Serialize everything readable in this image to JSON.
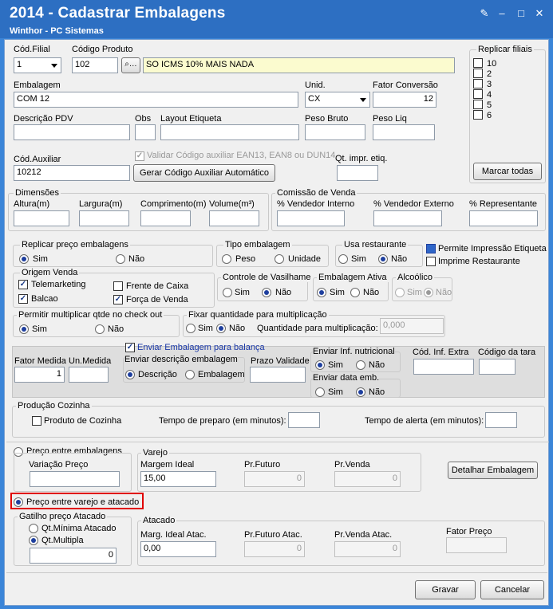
{
  "window": {
    "title": "2014 - Cadastrar Embalagens",
    "subtitle": "Winthor - PC Sistemas",
    "min_icon": "minimize-icon",
    "max_icon": "maximize-icon",
    "close_icon": "close-icon",
    "edit_icon": "edit-icon"
  },
  "top": {
    "filial_label": "Cód.Filial",
    "filial_value": "1",
    "produto_label": "Código Produto",
    "produto_value": "102",
    "produto_desc": "SO ICMS 10% MAIS NADA",
    "embalagem_label": "Embalagem",
    "embalagem_value": "COM 12",
    "unid_label": "Unid.",
    "unid_value": "CX",
    "fator_label": "Fator Conversão",
    "fator_value": "12",
    "desc_pdv_label": "Descrição PDV",
    "obs_label": "Obs",
    "layout_label": "Layout Etiqueta",
    "peso_bruto_label": "Peso Bruto",
    "peso_liq_label": "Peso Liq",
    "cod_aux_label": "Cód.Auxiliar",
    "cod_aux_value": "10212",
    "validar_label": "Validar Código auxiliar EAN13, EAN8 ou DUN14",
    "gerar_button": "Gerar Código Auxiliar Automático",
    "qt_impr_label": "Qt. impr. etiq."
  },
  "replicar": {
    "label": "Replicar filiais",
    "items": [
      "10",
      "2",
      "3",
      "4",
      "5",
      "6"
    ],
    "marcar_button": "Marcar todas"
  },
  "dimensoes": {
    "label": "Dimensões",
    "altura": "Altura(m)",
    "largura": "Largura(m)",
    "comprimento": "Comprimento(m)",
    "volume": "Volume(m³)"
  },
  "comissao": {
    "label": "Comissão de Venda",
    "interno": "% Vendedor Interno",
    "externo": "% Vendedor Externo",
    "representante": "% Representante"
  },
  "replicar_preco": {
    "label": "Replicar preço embalagens",
    "sim": "Sim",
    "nao": "Não"
  },
  "tipo_embalagem": {
    "label": "Tipo embalagem",
    "peso": "Peso",
    "unidade": "Unidade"
  },
  "usa_restaurante": {
    "label": "Usa restaurante",
    "sim": "Sim",
    "nao": "Não"
  },
  "permite_impressao": "Permite Impressão Etiqueta",
  "imprime_restaurante": "Imprime Restaurante",
  "origem_venda": {
    "label": "Origem Venda",
    "telemarketing": "Telemarketing",
    "balcao": "Balcao",
    "frente_caixa": "Frente de Caixa",
    "forca_venda": "Força de Venda"
  },
  "vasilhame": {
    "label": "Controle de Vasilhame",
    "sim": "Sim",
    "nao": "Não"
  },
  "emb_ativa": {
    "label": "Embalagem Ativa",
    "sim": "Sim",
    "nao": "Não"
  },
  "alcoolico": {
    "label": "Alcoólico",
    "sim": "Sim",
    "nao": "Não"
  },
  "permitir_mult": {
    "label": "Permitir multiplicar qtde no check out",
    "sim": "Sim",
    "nao": "Não"
  },
  "fixar_qtd": {
    "label": "Fixar quantidade para multiplicação",
    "sim": "Sim",
    "nao": "Não",
    "qtd_label": "Quantidade para multiplicação:",
    "qtd_value": "0,000"
  },
  "balanca": {
    "fator_label": "Fator Medida",
    "fator_value": "1",
    "un_label": "Un.Medida",
    "enviar_label": "Enviar Embalagem para balança",
    "desc_label": "Enviar descrição embalagem",
    "descricao": "Descrição",
    "embalagem": "Embalagem",
    "prazo_label": "Prazo Validade",
    "nutri_label": "Enviar Inf. nutricional",
    "sim": "Sim",
    "nao": "Não",
    "data_label": "Enviar data emb.",
    "cod_inf_label": "Cód. Inf. Extra",
    "cod_tara_label": "Código da tara"
  },
  "cozinha": {
    "label": "Produção Cozinha",
    "produto": "Produto de Cozinha",
    "preparo": "Tempo de preparo (em minutos):",
    "alerta": "Tempo de alerta (em minutos):"
  },
  "preco_emb": {
    "label": "Preço entre embalagens",
    "variacao": "Variação Preço",
    "varejo": "Varejo",
    "margem_label": "Margem Ideal",
    "margem_value": "15,00",
    "prfuturo_label": "Pr.Futuro",
    "prfuturo_value": "0",
    "prvenda_label": "Pr.Venda",
    "prvenda_value": "0",
    "detalhar_button": "Detalhar Embalagem"
  },
  "preco_var": {
    "label": "Preço entre varejo e atacado",
    "gatilho": "Gatilho preço Atacado",
    "qtmin": "Qt.Mínima Atacado",
    "qtmult": "Qt.Multipla",
    "qt_value": "0",
    "atacado": "Atacado",
    "marg_label": "Marg. Ideal Atac.",
    "marg_value": "0,00",
    "prfut_label": "Pr.Futuro Atac.",
    "prfut_value": "0",
    "prvend_label": "Pr.Venda Atac.",
    "prvend_value": "0",
    "fator_preco": "Fator Preço"
  },
  "footer": {
    "gravar": "Gravar",
    "cancelar": "Cancelar"
  }
}
